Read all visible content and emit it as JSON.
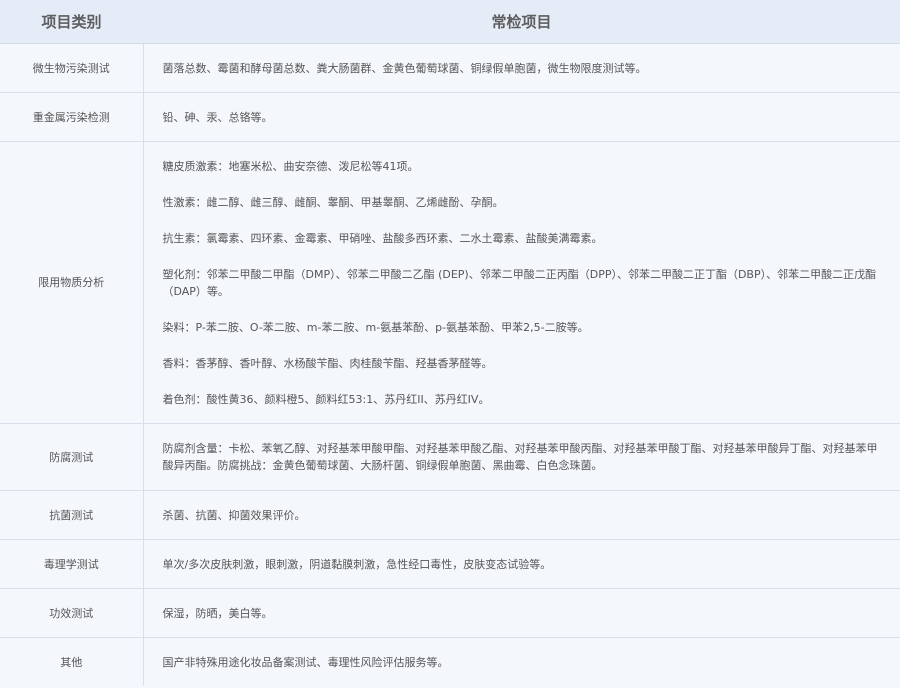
{
  "header": {
    "col_category": "项目类别",
    "col_items": "常检项目"
  },
  "rows": [
    {
      "category": "微生物污染测试",
      "content": [
        "菌落总数、霉菌和酵母菌总数、粪大肠菌群、金黄色葡萄球菌、铜绿假单胞菌，微生物限度测试等。"
      ]
    },
    {
      "category": "重金属污染检测",
      "content": [
        "铅、砷、汞、总铬等。"
      ]
    },
    {
      "category": "限用物质分析",
      "content": [
        "糖皮质激素：地塞米松、曲安奈德、泼尼松等41项。",
        "性激素：雌二醇、雌三醇、雌酮、睾酮、甲基睾酮、乙烯雌酚、孕酮。",
        "抗生素：氯霉素、四环素、金霉素、甲硝唑、盐酸多西环素、二水土霉素、盐酸美满霉素。",
        "塑化剂：邻苯二甲酸二甲酯（DMP）、邻苯二甲酸二乙酯 (DEP)、邻苯二甲酸二正丙酯（DPP）、邻苯二甲酸二正丁酯（DBP）、邻苯二甲酸二正戊酯（DAP）等。",
        "染料：P-苯二胺、O-苯二胺、m-苯二胺、m-氨基苯酚、p-氨基苯酚、甲苯2,5-二胺等。",
        "香料：香茅醇、香叶醇、水杨酸苄酯、肉桂酸苄酯、羟基香茅醛等。",
        "着色剂：酸性黄36、颜料橙5、颜料红53:1、苏丹红II、苏丹红IV。"
      ]
    },
    {
      "category": "防腐测试",
      "content": [
        "防腐剂含量：卡松、苯氧乙醇、对羟基苯甲酸甲酯、对羟基苯甲酸乙酯、对羟基苯甲酸丙酯、对羟基苯甲酸丁酯、对羟基苯甲酸异丁酯、对羟基苯甲酸异丙酯。防腐挑战：金黄色葡萄球菌、大肠杆菌、铜绿假单胞菌、黑曲霉、白色念珠菌。"
      ]
    },
    {
      "category": "抗菌测试",
      "content": [
        "杀菌、抗菌、抑菌效果评价。"
      ]
    },
    {
      "category": "毒理学测试",
      "content": [
        "单次/多次皮肤刺激，眼刺激，阴道黏膜刺激，急性经口毒性，皮肤变态试验等。"
      ]
    },
    {
      "category": "功效测试",
      "content": [
        "保湿，防晒，美白等。"
      ]
    },
    {
      "category": "其他",
      "content": [
        "国产非特殊用途化妆品备案测试、毒理性风险评估服务等。"
      ]
    }
  ]
}
